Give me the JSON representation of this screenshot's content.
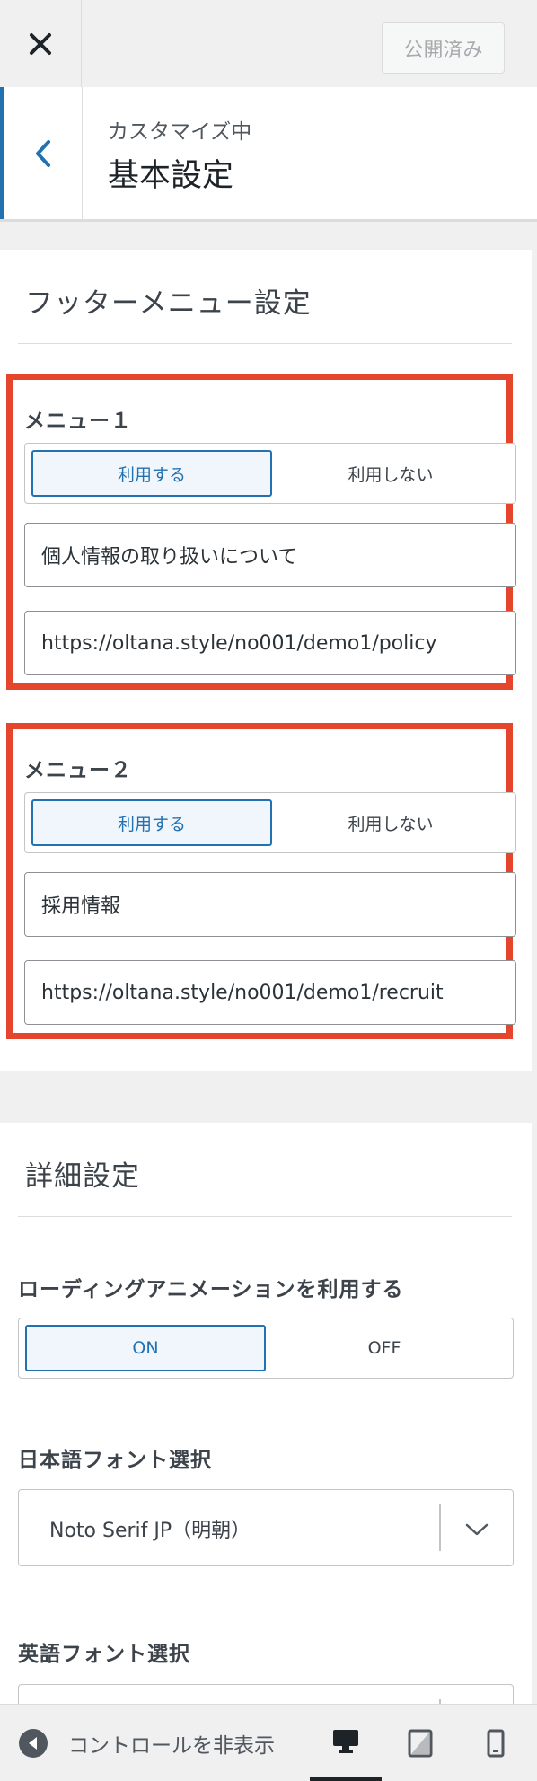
{
  "topbar": {
    "close_label": "✕",
    "publish_label": "公開済み"
  },
  "section": {
    "subtitle": "カスタマイズ中",
    "title": "基本設定"
  },
  "footer_menu": {
    "title": "フッターメニュー設定",
    "menus": [
      {
        "label": "メニュー１",
        "use_label": "利用する",
        "nouse_label": "利用しない",
        "selected": "利用する",
        "text_value": "個人情報の取り扱いについて",
        "url_value": "https://oltana.style/no001/demo1/policy"
      },
      {
        "label": "メニュー２",
        "use_label": "利用する",
        "nouse_label": "利用しない",
        "selected": "利用する",
        "text_value": "採用情報",
        "url_value": "https://oltana.style/no001/demo1/recruit"
      }
    ]
  },
  "detail": {
    "title": "詳細設定",
    "loading_label": "ローディングアニメーションを利用する",
    "on_label": "ON",
    "off_label": "OFF",
    "loading_selected": "ON",
    "jp_font_label": "日本語フォント選択",
    "jp_font_value": "Noto Serif JP（明朝）",
    "en_font_label": "英語フォント選択"
  },
  "bottombar": {
    "collapse_label": "コントロールを非表示",
    "active_device": "desktop"
  },
  "colors": {
    "accent": "#2271b1",
    "highlight": "#e5452d"
  }
}
